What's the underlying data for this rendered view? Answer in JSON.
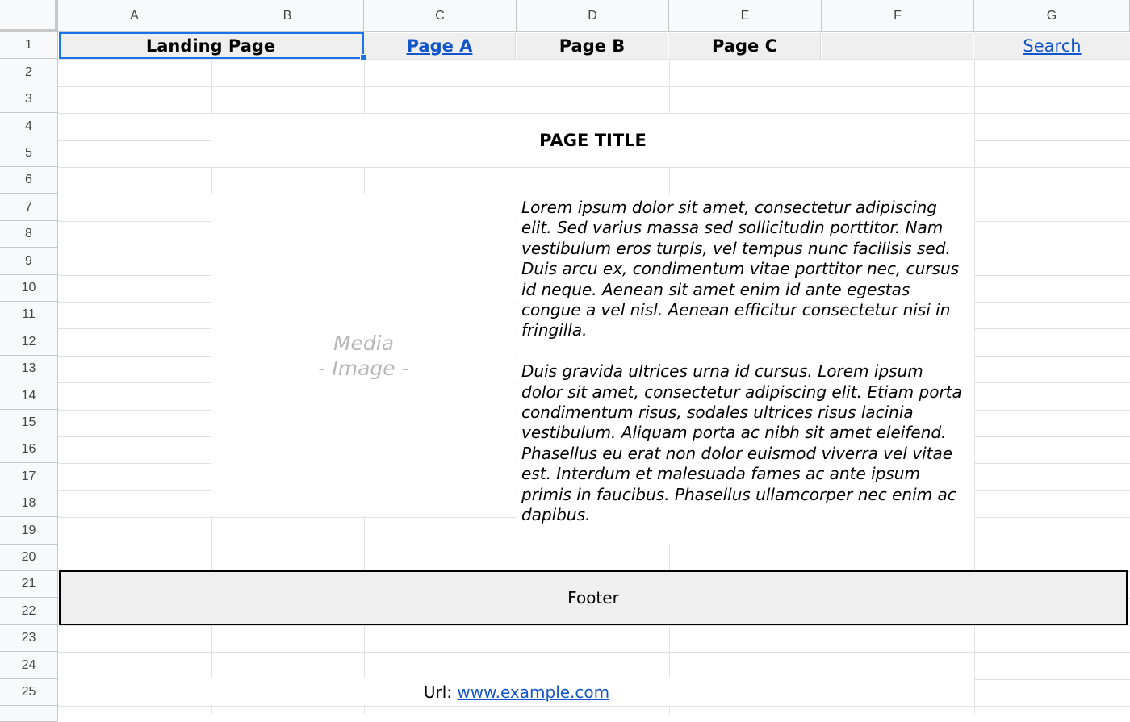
{
  "columns": [
    "A",
    "B",
    "C",
    "D",
    "E",
    "F",
    "G"
  ],
  "rows": [
    "1",
    "2",
    "3",
    "4",
    "5",
    "6",
    "7",
    "8",
    "9",
    "10",
    "11",
    "12",
    "13",
    "14",
    "15",
    "16",
    "17",
    "18",
    "19",
    "20",
    "21",
    "22",
    "23",
    "24",
    "25"
  ],
  "nav": {
    "landing": "Landing Page",
    "page_a": "Page A",
    "page_b": "Page B",
    "page_c": "Page C",
    "search": "Search"
  },
  "page_title": "PAGE TITLE",
  "media": {
    "line1": "Media",
    "line2": "- Image -"
  },
  "body_text": "Lorem ipsum dolor sit amet, consectetur adipiscing elit. Sed varius massa sed sollicitudin porttitor. Nam vestibulum eros turpis, vel tempus nunc facilisis sed. Duis arcu ex, condimentum vitae porttitor nec, cursus id neque. Aenean sit amet enim id ante egestas congue a vel nisl. Aenean efficitur consectetur nisi in fringilla.\n\nDuis gravida ultrices urna id cursus. Lorem ipsum dolor sit amet, consectetur adipiscing elit. Etiam porta condimentum risus, sodales ultrices risus lacinia vestibulum. Aliquam porta ac nibh sit amet eleifend. Phasellus eu erat non dolor euismod viverra vel vitae est. Interdum et malesuada fames ac ante ipsum primis in faucibus. Phasellus ullamcorper nec enim ac dapibus.",
  "footer": "Footer",
  "url": {
    "label": "Url:",
    "link": "www.example.com"
  },
  "colors": {
    "link": "#1155cc",
    "selection": "#1a73e8",
    "header_bg": "#f8f9fa",
    "nav_bg": "#efefef"
  }
}
